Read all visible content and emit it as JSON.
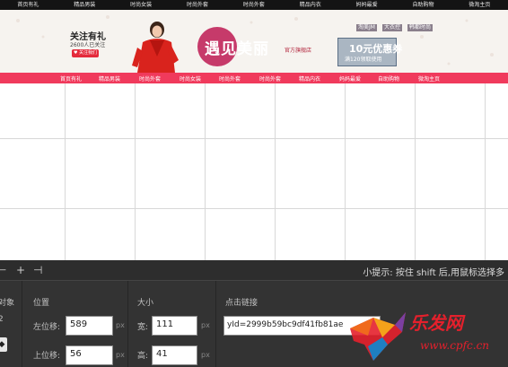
{
  "top_nav": [
    "首页有礼",
    "精品男装",
    "时尚女装",
    "时尚外套",
    "时尚外套",
    "精品内衣",
    "妈妈最爱",
    "自助购物",
    "微淘主页"
  ],
  "banner": {
    "follow_title": "关注有礼",
    "follow_count": "2600人已关注",
    "follow_button": "♥ 关注我们",
    "brand_name": "遇见美丽",
    "brand_sub": "官方旗舰店",
    "brand_links": [
      "淘美JM",
      "大衣控",
      "韩都时尚"
    ],
    "coupon_amount": "10元优惠券",
    "coupon_condition": "满120领取使用"
  },
  "pink_nav": [
    "首页有礼",
    "精品男装",
    "时尚外套",
    "时尚女装",
    "时尚外套",
    "时尚外套",
    "精品内衣",
    "妈妈最爱",
    "自助购物",
    "微淘主页"
  ],
  "toolbar": {
    "tip": "小提示: 按住 shift 后,用鼠标选择多"
  },
  "panel": {
    "object_label": "对象",
    "object_value": "2",
    "position_label": "位置",
    "left_label": "左位移:",
    "left_value": "589",
    "top_label": "上位移:",
    "top_value": "56",
    "px_unit": "px",
    "size_label": "大小",
    "width_label": "宽:",
    "width_value": "111",
    "height_label": "高:",
    "height_value": "41",
    "link_label": "点击链接",
    "link_value": "yId=2999b59bc9df41fb81ae"
  },
  "watermark": {
    "name": "乐发网",
    "url": "www.cpfc.cn"
  },
  "colors": {
    "topnav_bg": "#141414",
    "pinknav_bg": "#f03a5c",
    "panel_bg": "#333333",
    "brand_red": "#e42b3c"
  }
}
